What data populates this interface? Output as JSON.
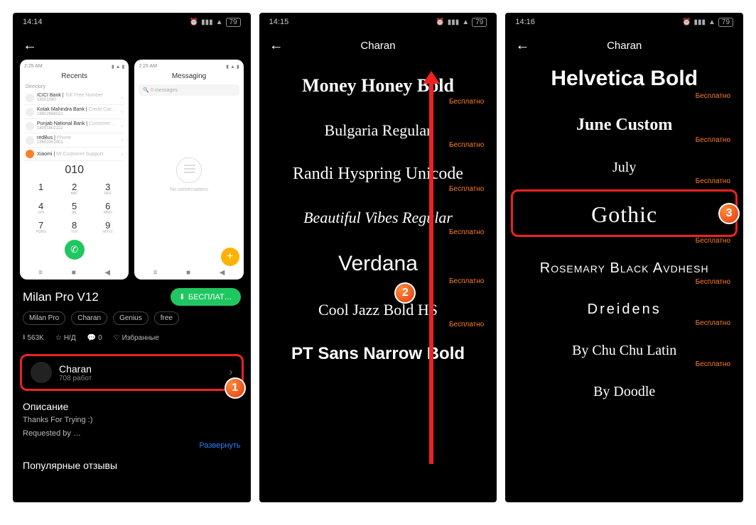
{
  "screens": [
    {
      "time": "14:14",
      "battery": "79"
    },
    {
      "time": "14:15",
      "battery": "79",
      "title": "Charan"
    },
    {
      "time": "14:16",
      "battery": "79",
      "title": "Charan"
    }
  ],
  "screen1": {
    "preview_left": {
      "time": "2:25 AM",
      "title": "Recents",
      "directory_label": "Directory",
      "contacts": [
        {
          "name": "ICICI Bank",
          "sub": "Toll Free Number",
          "phone": "18001080"
        },
        {
          "name": "Kotak Mahindra Bank",
          "sub": "Credit Car…",
          "phone": "18602666022"
        },
        {
          "name": "Punjab National Bank",
          "sub": "Customer…",
          "phone": "18001802222"
        },
        {
          "name": "redBus",
          "sub": "Phone",
          "phone": "18602001001"
        },
        {
          "name": "Xiaomi",
          "sub": "Mi Customer Support",
          "phone": "",
          "orange": true
        }
      ],
      "dialed": "010",
      "keypad": [
        [
          "1",
          ""
        ],
        [
          "2",
          "ABC"
        ],
        [
          "3",
          "DEF"
        ],
        [
          "4",
          "GHI"
        ],
        [
          "5",
          "JKL"
        ],
        [
          "6",
          "MNO"
        ],
        [
          "7",
          "PQRS"
        ],
        [
          "8",
          "TUV"
        ],
        [
          "9",
          "WXYZ"
        ]
      ]
    },
    "preview_right": {
      "time": "2:25 AM",
      "title": "Messaging",
      "search_placeholder": "0 messages",
      "empty_text": "No conversations"
    },
    "theme_title": "Milan Pro V12",
    "download_button": "БЕСПЛАТ…",
    "tags": [
      "Milan Pro",
      "Charan",
      "Genius",
      "free"
    ],
    "stats": {
      "downloads": "563K",
      "rating": "Н/Д",
      "comments": "0",
      "fav": "Избранные"
    },
    "author": {
      "name": "Charan",
      "works": "708 работ"
    },
    "description_header": "Описание",
    "description_lines": [
      "Thanks For Trying :)",
      "Requested by …"
    ],
    "expand": "Развернуть",
    "reviews_header": "Популярные отзывы"
  },
  "screen2_fonts": [
    "Money Honey Bold",
    "Bulgaria Regular",
    "Randi Hyspring Unicode",
    "Beautiful Vibes Regular",
    "Verdana",
    "Cool Jazz Bold HS",
    "PT Sans Narrow Bold"
  ],
  "screen3_fonts": [
    "Helvetica Bold",
    "June Custom",
    "July",
    "Gothic",
    "Rosemary Black Avdhesh",
    "Dreidens",
    "By Chu Chu Latin",
    "By Doodle"
  ],
  "free_label": "Бесплатно",
  "step_labels": [
    "1",
    "2",
    "3"
  ]
}
